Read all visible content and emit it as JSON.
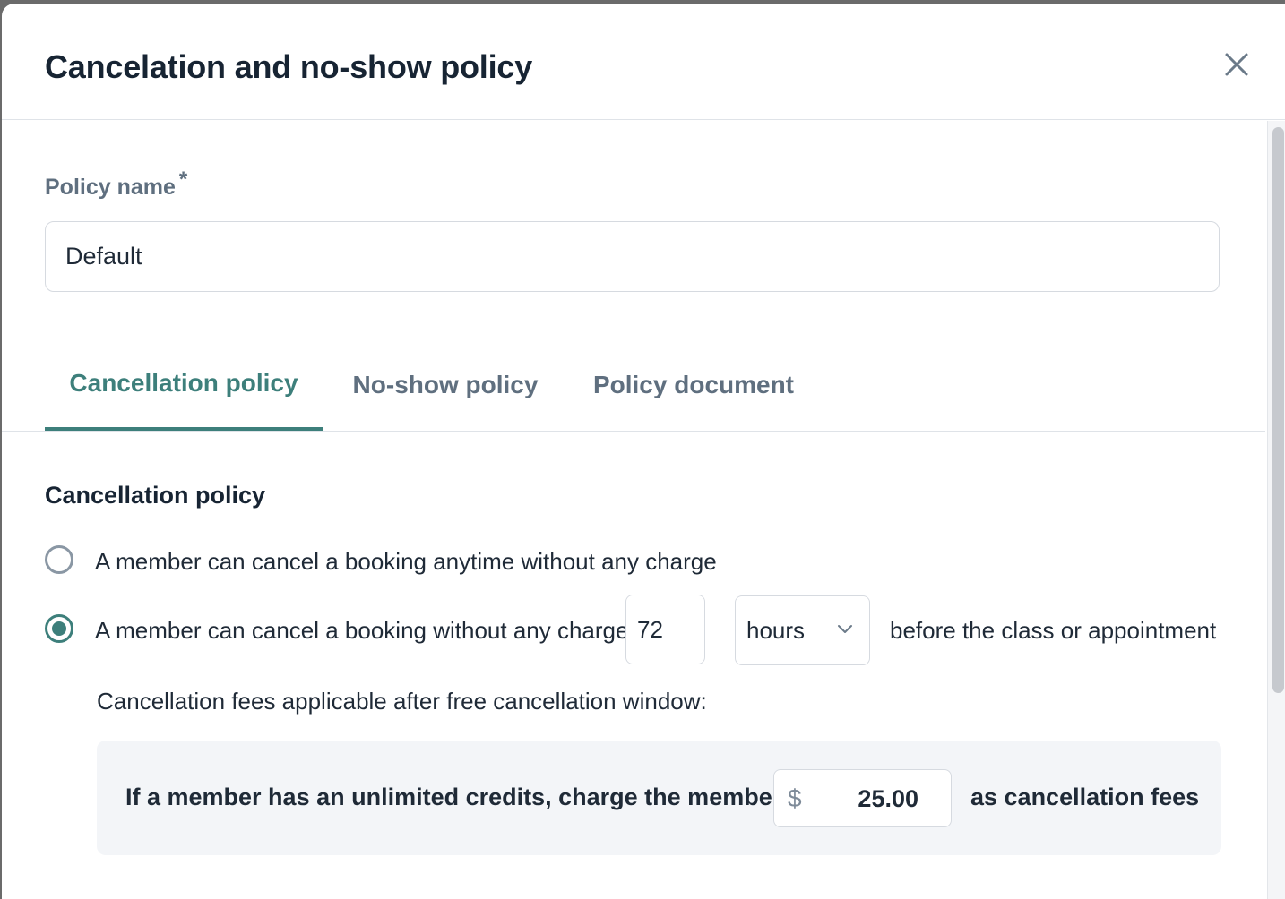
{
  "modal": {
    "title": "Cancelation and no-show policy",
    "close_icon": "close-icon"
  },
  "policy_name": {
    "label": "Policy name",
    "required_mark": "*",
    "value": "Default"
  },
  "tabs": [
    {
      "label": "Cancellation policy",
      "active": true
    },
    {
      "label": "No-show policy",
      "active": false
    },
    {
      "label": "Policy document",
      "active": false
    }
  ],
  "cancellation": {
    "section_title": "Cancellation policy",
    "options": [
      {
        "label": "A member can cancel a booking anytime without any charge",
        "selected": false
      },
      {
        "label": "A member can cancel a booking without any charge",
        "selected": true
      }
    ],
    "window_value": "72",
    "window_unit": "hours",
    "window_suffix": "before the class or appointment",
    "fees_heading": "Cancellation fees applicable after free cancellation window:",
    "fee_rule": {
      "prefix": "If a member has an unlimited credits, charge the member",
      "currency": "$",
      "amount": "25.00",
      "suffix": "as cancellation fees"
    }
  },
  "colors": {
    "accent": "#3d7f7b",
    "title_text": "#172433",
    "muted_text": "#5f6f7f",
    "border": "#d6dae0",
    "fees_background": "#f3f5f8"
  }
}
